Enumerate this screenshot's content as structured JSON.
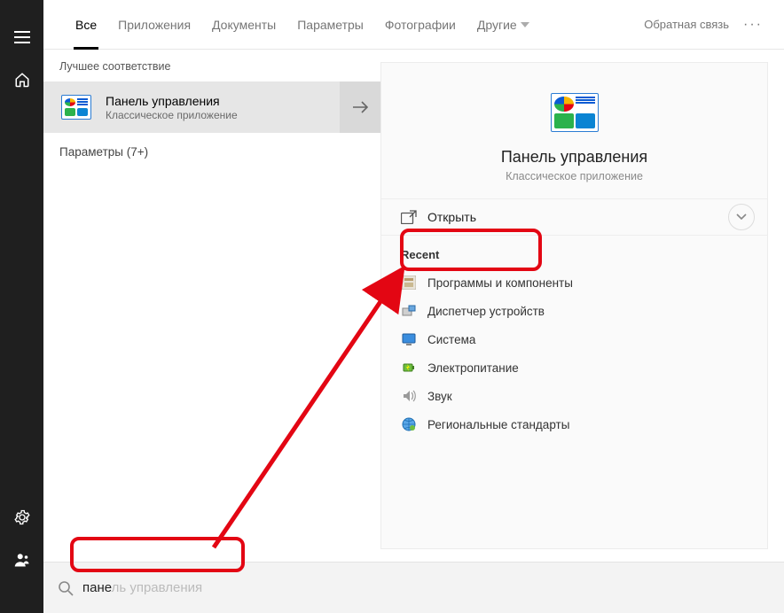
{
  "tabs": {
    "all": "Все",
    "apps": "Приложения",
    "docs": "Документы",
    "settings": "Параметры",
    "photos": "Фотографии",
    "more": "Другие"
  },
  "feedback": "Обратная связь",
  "sections": {
    "best_match": "Лучшее соответствие",
    "settings_group": "Параметры (7+)"
  },
  "result": {
    "title": "Панель управления",
    "subtitle": "Классическое приложение"
  },
  "details": {
    "title": "Панель управления",
    "subtitle": "Классическое приложение",
    "open": "Открыть",
    "recent_label": "Recent",
    "recent": [
      "Программы и компоненты",
      "Диспетчер устройств",
      "Система",
      "Электропитание",
      "Звук",
      "Региональные стандарты"
    ]
  },
  "search": {
    "typed": "пане",
    "suggest": "ль управления"
  }
}
